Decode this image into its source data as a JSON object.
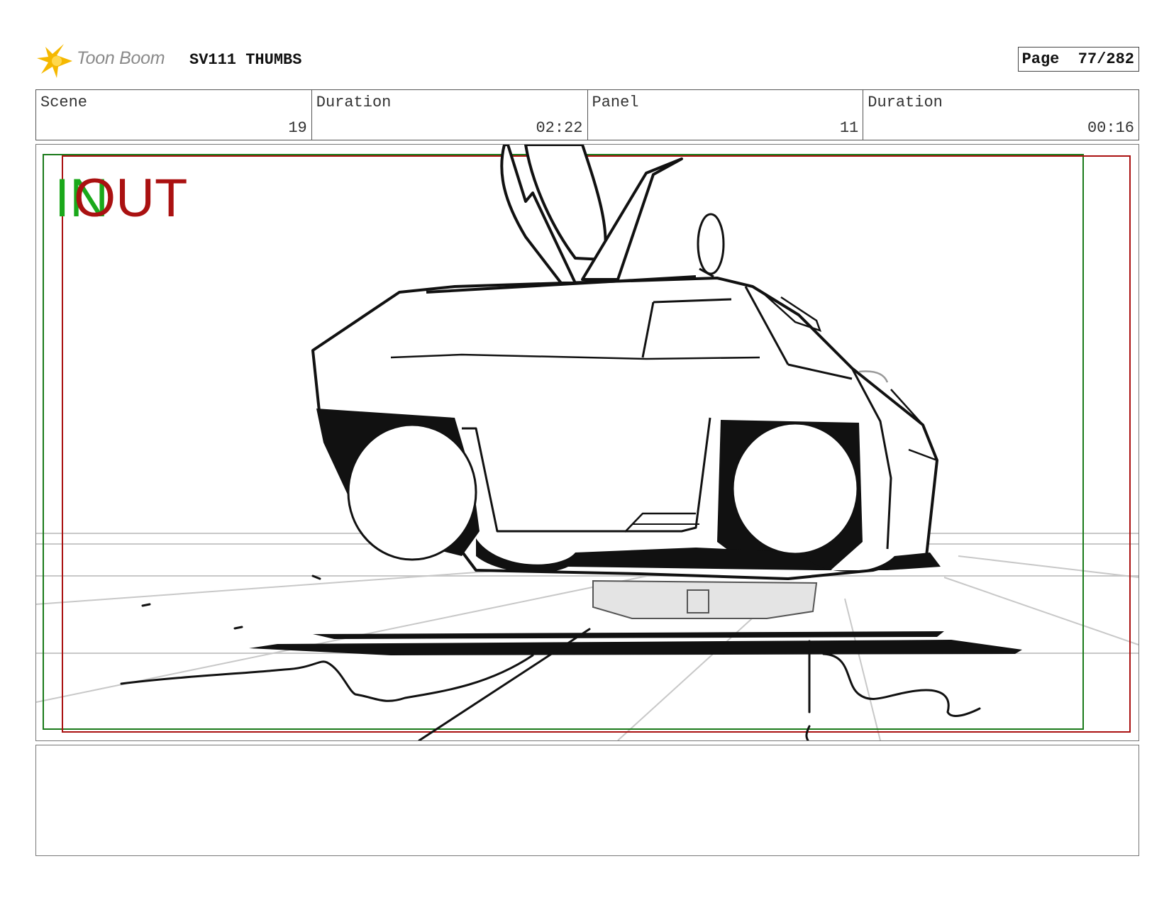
{
  "header": {
    "logo_text": "Toon Boom",
    "project_title": "SV111 THUMBS",
    "page_label": "Page",
    "page_value": "77/282"
  },
  "info": {
    "scene_label": "Scene",
    "scene_value": "19",
    "scene_duration_label": "Duration",
    "scene_duration_value": "02:22",
    "panel_label": "Panel",
    "panel_value": "11",
    "panel_duration_label": "Duration",
    "panel_duration_value": "00:16"
  },
  "panel": {
    "in_marker": "IN",
    "out_marker": "OUT",
    "in_frame_color": "#1a7a1a",
    "out_frame_color": "#aa1111",
    "sketch_subject": "car-sketch"
  },
  "notes": {
    "text": ""
  },
  "colors": {
    "logo_star": "#f5b800",
    "in_marker": "#1aa81a",
    "out_marker": "#aa1111"
  }
}
